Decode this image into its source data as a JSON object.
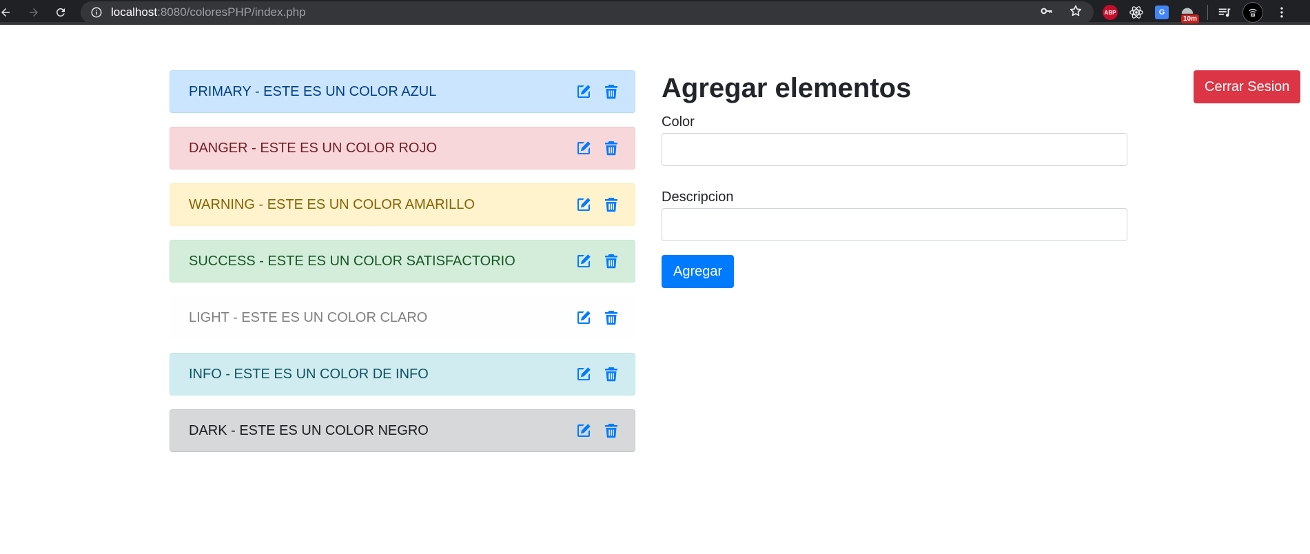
{
  "browser": {
    "url_host": "localhost",
    "url_rest": ":8080/coloresPHP/index.php",
    "extensions": {
      "abp_label": "ABP",
      "translate_label": "G",
      "timer_badge": "10m"
    }
  },
  "colors": {
    "primary": {
      "bg": "#cce5ff",
      "border": "#b8daff",
      "text": "#004085"
    },
    "danger": {
      "bg": "#f8d7da",
      "border": "#f5c6cb",
      "text": "#721c24"
    },
    "warning": {
      "bg": "#fff3cd",
      "border": "#ffeeba",
      "text": "#856404"
    },
    "success": {
      "bg": "#d4edda",
      "border": "#c3e6cb",
      "text": "#155724"
    },
    "light": {
      "bg": "#fefefe",
      "border": "#fdfdfe",
      "text": "#818182"
    },
    "info": {
      "bg": "#d1ecf1",
      "border": "#bee5eb",
      "text": "#0c5460"
    },
    "dark": {
      "bg": "#d6d8d9",
      "border": "#c6c8ca",
      "text": "#1b1e21"
    },
    "accent": "#007bff"
  },
  "items": [
    {
      "type": "primary",
      "text": "PRIMARY - ESTE ES UN COLOR AZUL"
    },
    {
      "type": "danger",
      "text": "DANGER - ESTE ES UN COLOR ROJO"
    },
    {
      "type": "warning",
      "text": "WARNING - ESTE ES UN COLOR AMARILLO"
    },
    {
      "type": "success",
      "text": "SUCCESS - ESTE ES UN COLOR SATISFACTORIO"
    },
    {
      "type": "light",
      "text": "LIGHT - ESTE ES UN COLOR CLARO"
    },
    {
      "type": "info",
      "text": "INFO - ESTE ES UN COLOR DE INFO"
    },
    {
      "type": "dark",
      "text": "DARK - ESTE ES UN COLOR NEGRO"
    }
  ],
  "item_icons": {
    "edit": "edit-icon",
    "delete": "trash-icon"
  },
  "form": {
    "title": "Agregar elementos",
    "color_label": "Color",
    "color_value": "",
    "description_label": "Descripcion",
    "description_value": "",
    "submit_label": "Agregar"
  },
  "logout_label": "Cerrar Sesion"
}
